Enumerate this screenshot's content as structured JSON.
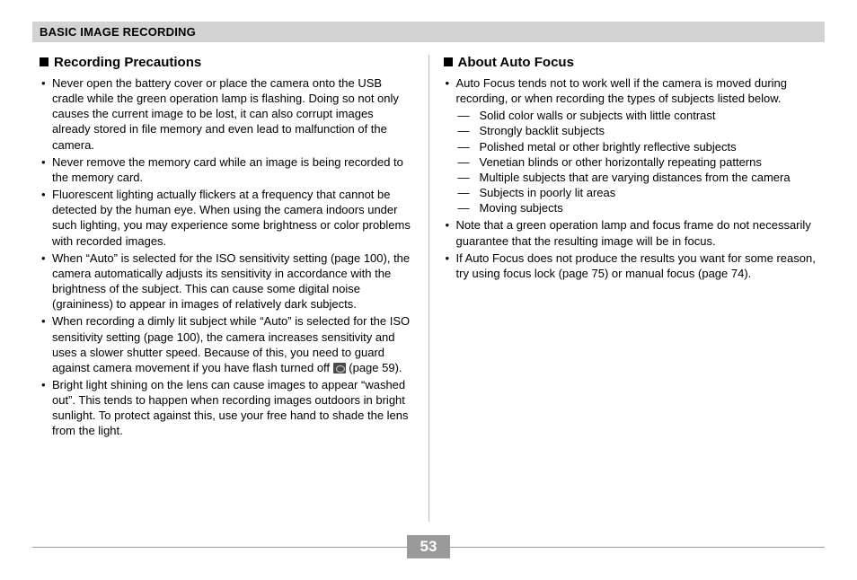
{
  "header": "BASIC IMAGE RECORDING",
  "page_number": "53",
  "left": {
    "title": "Recording Precautions",
    "items": [
      "Never open the battery cover or place the camera onto the USB cradle while the green operation lamp is flashing. Doing so not only causes the current image to be lost, it can also corrupt images already stored in file memory and even lead to malfunction of the camera.",
      "Never remove the memory card while an image is being recorded to the memory card.",
      "Fluorescent lighting actually flickers at a frequency that cannot be detected by the human eye. When using the camera indoors under such lighting, you may experience some brightness or color problems with recorded images.",
      "When “Auto” is selected for the ISO sensitivity setting (page 100), the camera automatically adjusts its sensitivity in accordance with the brightness of the subject. This can cause some digital noise (graininess) to appear in images of relatively dark subjects."
    ],
    "item_with_icon_pre": "When recording a dimly lit subject while “Auto” is selected for the ISO sensitivity setting (page 100), the camera increases sensitivity and uses a slower shutter speed. Because of this, you need to guard against camera movement if you have flash turned off ",
    "item_with_icon_post": " (page 59).",
    "item_last": "Bright light shining on the lens can cause images to appear “washed out”. This tends to happen when recording images outdoors in bright sunlight. To protect against this, use your free hand to shade the lens from the light."
  },
  "right": {
    "title": "About Auto Focus",
    "intro": "Auto Focus tends not to work well if the camera is moved during recording, or when recording the types of subjects listed below.",
    "dash_items": [
      "Solid color walls or subjects with little contrast",
      "Strongly backlit subjects",
      "Polished metal or other brightly reflective subjects",
      "Venetian blinds or other horizontally repeating patterns",
      "Multiple subjects that are varying distances from the camera",
      "Subjects in poorly lit areas",
      "Moving subjects"
    ],
    "items_after": [
      "Note that a green operation lamp and focus frame do not necessarily guarantee that the resulting image will be in focus.",
      "If Auto Focus does not produce the results you want for some reason, try using focus lock (page 75) or manual focus (page 74)."
    ]
  }
}
